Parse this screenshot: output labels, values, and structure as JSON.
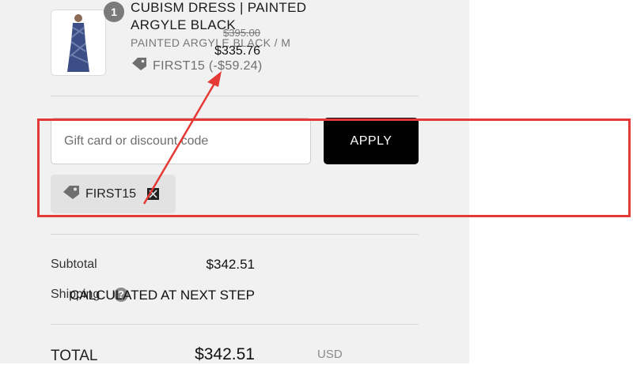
{
  "order": {
    "quantity": "1",
    "product_name": "CUBISM DRESS | PAINTED ARGYLE BLACK",
    "variant": "PAINTED ARGYLE BLACK / M",
    "discount_applied": "FIRST15 (-$59.24)",
    "original_price": "$395.00",
    "final_price": "$335.76"
  },
  "discount_form": {
    "input_placeholder": "Gift card or discount code",
    "input_value": "",
    "apply_label": "APPLY",
    "applied_code": "FIRST15"
  },
  "summary": {
    "subtotal_label": "Subtotal",
    "subtotal_value": "$342.51",
    "shipping_label": "Shipping",
    "shipping_value": "CALCULATED AT NEXT STEP",
    "help_glyph": "?",
    "total_label": "TOTAL",
    "currency": "USD",
    "total_value": "$342.51"
  },
  "icons": {
    "tag": "tag-icon",
    "close": "close-icon",
    "help": "help-icon"
  },
  "colors": {
    "panel_bg": "#f1f1f1",
    "apply_button": "#000000",
    "annotation": "#e53935"
  }
}
